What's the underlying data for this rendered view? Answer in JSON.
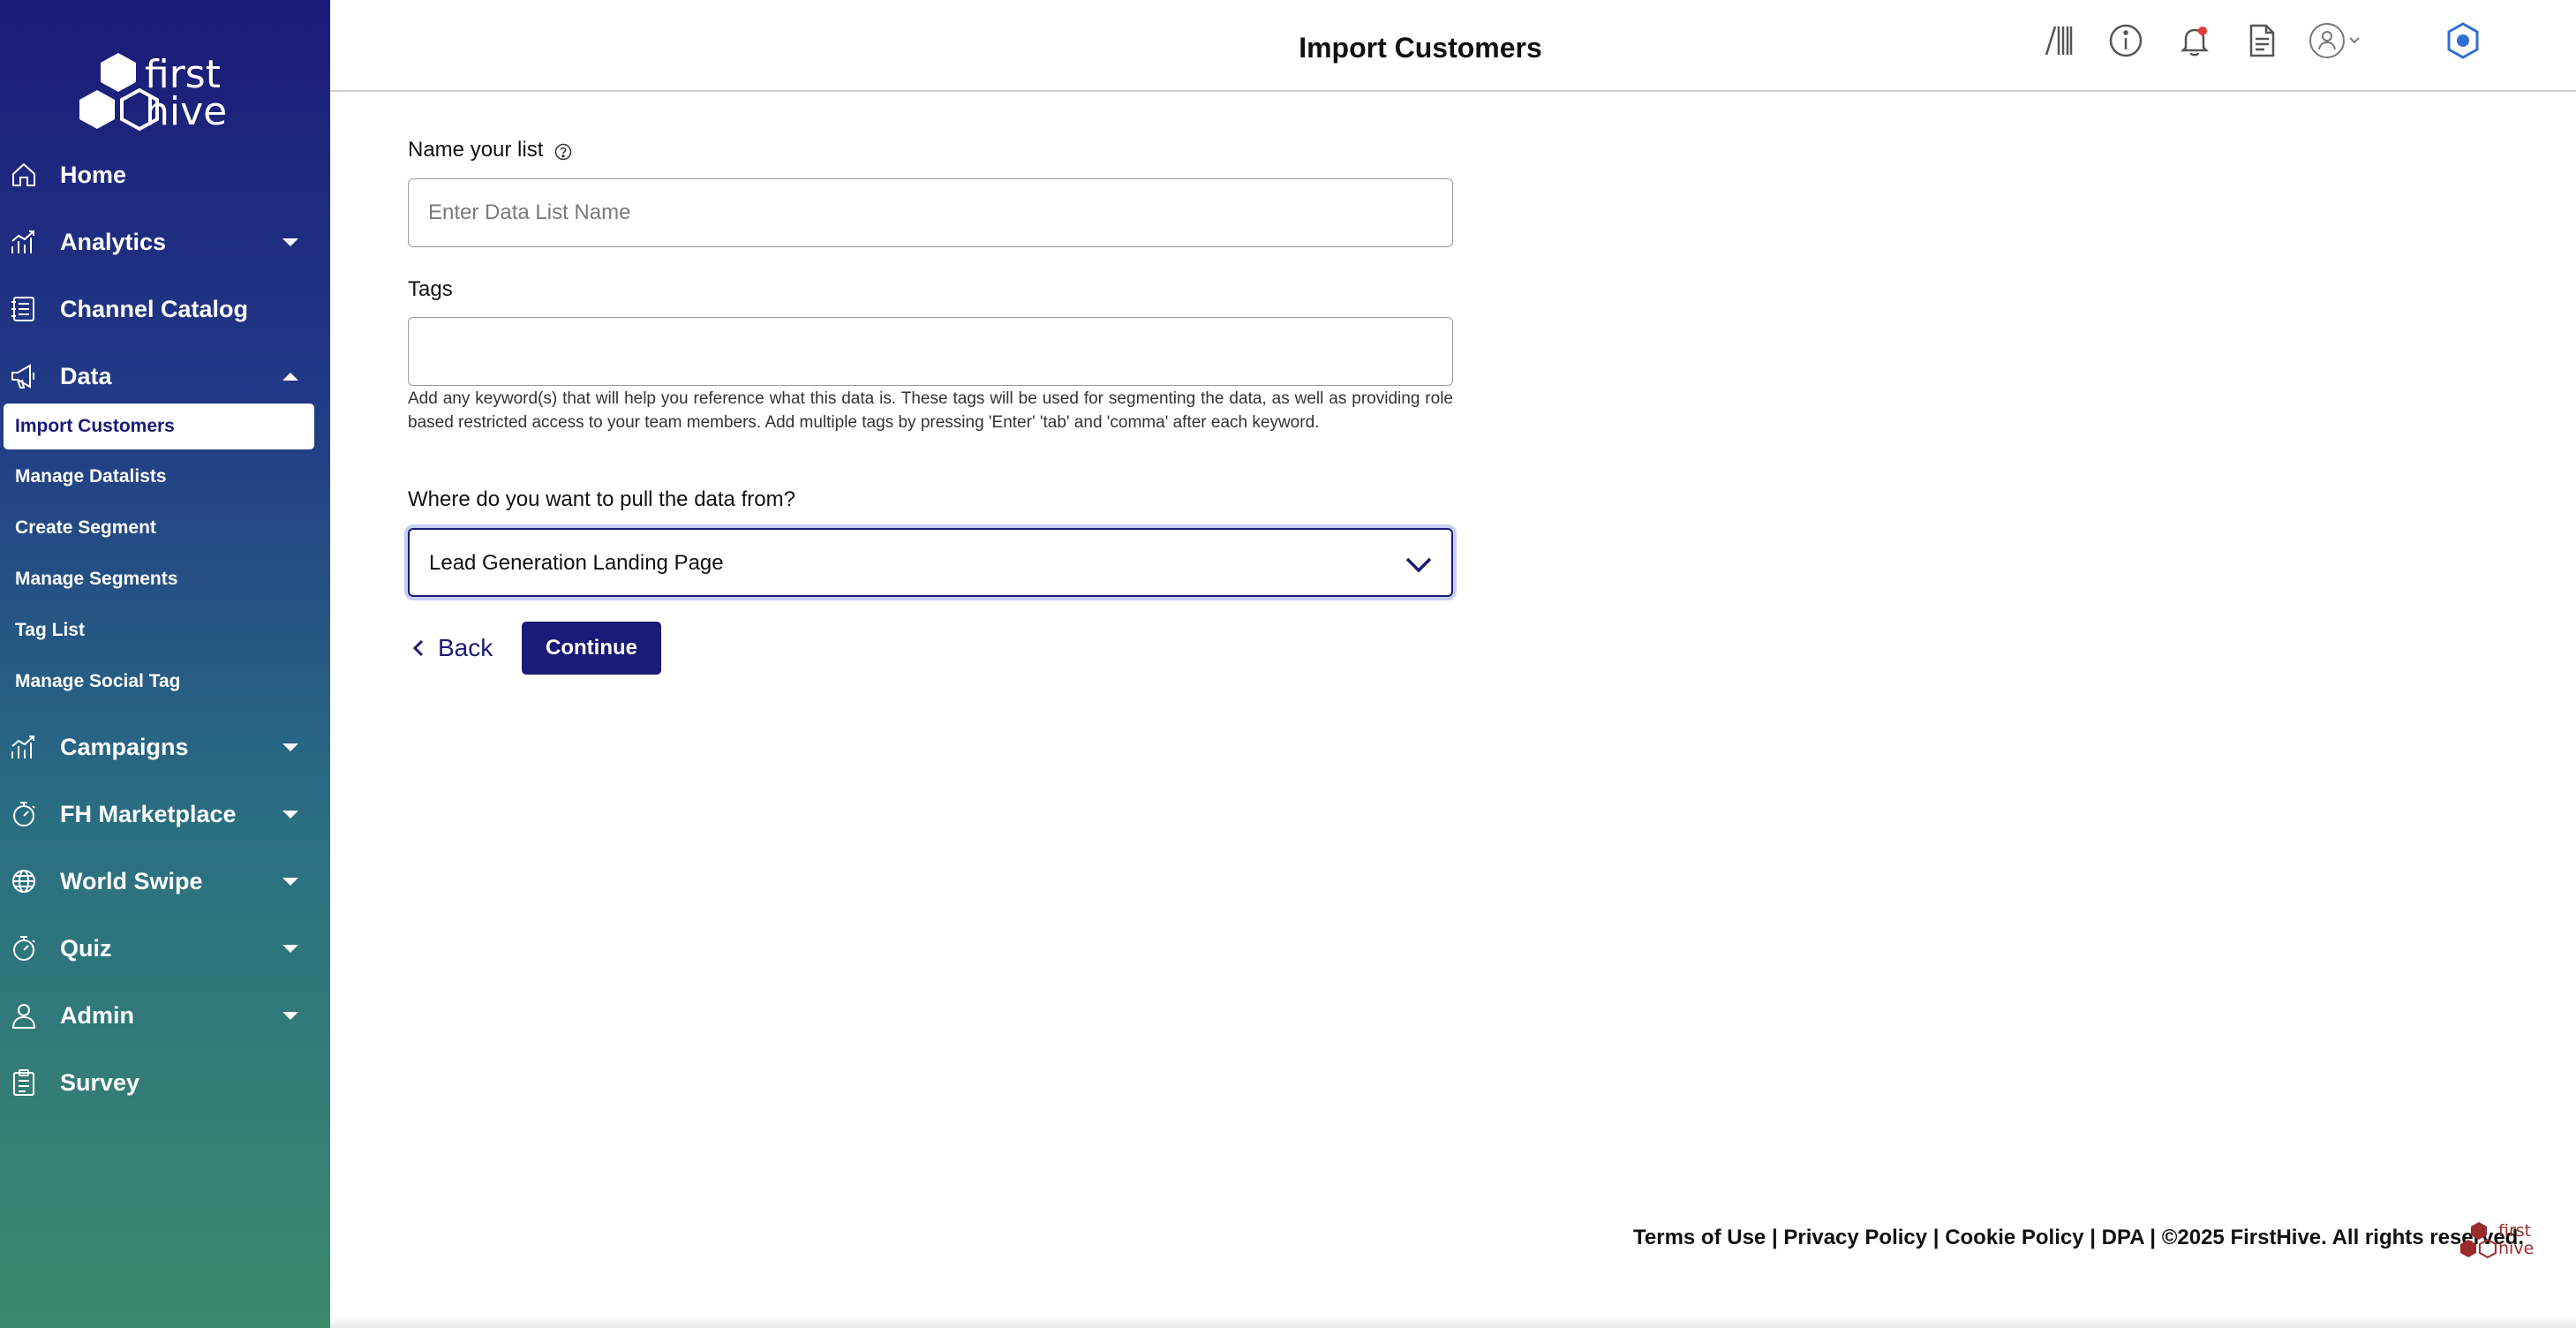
{
  "app": {
    "logo_text": "first\nhive",
    "logo_word_1": "first",
    "logo_word_2": "hive"
  },
  "sidebar": {
    "items": [
      {
        "label": "Home",
        "icon": "home-icon",
        "expandable": false
      },
      {
        "label": "Analytics",
        "icon": "analytics-icon",
        "expandable": true
      },
      {
        "label": "Channel Catalog",
        "icon": "catalog-icon",
        "expandable": false
      },
      {
        "label": "Data",
        "icon": "megaphone-icon",
        "expandable": true,
        "expanded": true
      },
      {
        "label": "Campaigns",
        "icon": "campaigns-icon",
        "expandable": true
      },
      {
        "label": "FH Marketplace",
        "icon": "stopwatch-icon",
        "expandable": true
      },
      {
        "label": "World Swipe",
        "icon": "globe-icon",
        "expandable": true
      },
      {
        "label": "Quiz",
        "icon": "stopwatch-icon",
        "expandable": true
      },
      {
        "label": "Admin",
        "icon": "user-icon",
        "expandable": true
      },
      {
        "label": "Survey",
        "icon": "clipboard-icon",
        "expandable": false
      }
    ],
    "data_subitems": [
      {
        "label": "Import Customers",
        "active": true
      },
      {
        "label": "Manage Datalists",
        "active": false
      },
      {
        "label": "Create Segment",
        "active": false
      },
      {
        "label": "Manage Segments",
        "active": false
      },
      {
        "label": "Tag List",
        "active": false
      },
      {
        "label": "Manage Social Tag",
        "active": false
      }
    ]
  },
  "header": {
    "title": "Import Customers",
    "icons": [
      "barcode-icon",
      "info-icon",
      "bell-icon",
      "document-icon",
      "user-avatar-icon",
      "chevron-down-icon",
      "hexagon-settings-icon"
    ],
    "notification_dot_color": "#e53935"
  },
  "form": {
    "name_label": "Name your list",
    "name_placeholder": "Enter Data List Name",
    "name_value": "",
    "tags_label": "Tags",
    "tags_value": "",
    "tags_hint": "Add any keyword(s) that will help you reference what this data is. These tags will be used for segmenting the data, as well as providing role based restricted access to your team members. Add multiple tags by pressing 'Enter' 'tab' and 'comma' after each keyword.",
    "source_label": "Where do you want to pull the data from?",
    "source_selected": "Lead Generation Landing Page",
    "back_label": "Back",
    "continue_label": "Continue"
  },
  "footer": {
    "terms": "Terms of Use",
    "privacy": "Privacy Policy",
    "cookie": "Cookie Policy",
    "dpa": "DPA",
    "copyright": "©2025 FirstHive. All rights reserved.",
    "separator": " | "
  },
  "colors": {
    "brand_navy": "#1b1a78",
    "sidebar_gradient_top": "#1b1a78",
    "sidebar_gradient_bottom": "#3c8a6c",
    "footer_logo": "#9b2c2c",
    "header_accent": "#2f6fd6"
  }
}
